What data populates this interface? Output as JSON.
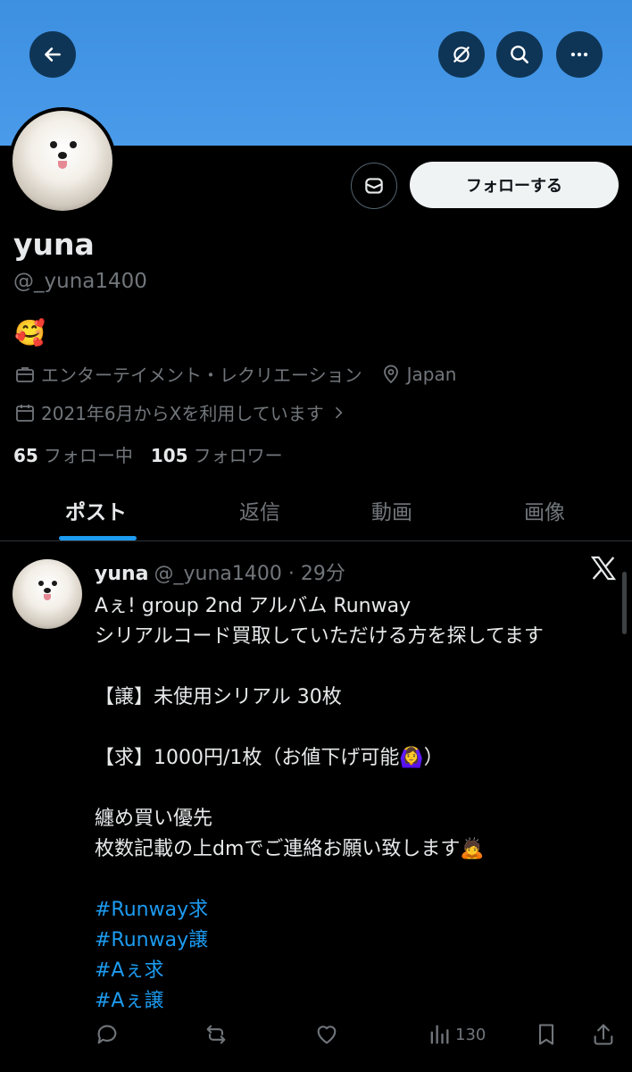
{
  "header": {
    "back_icon": "arrow-left-icon",
    "translate_icon": "grok-icon",
    "search_icon": "search-icon",
    "more_icon": "more-icon"
  },
  "profile": {
    "dm_icon": "mail-icon",
    "follow_label": "フォローする",
    "name": "yuna",
    "handle": "@_yuna1400",
    "bio": "🥰",
    "category": "エンターテイメント・レクリエーション",
    "location": "Japan",
    "joined": "2021年6月からXを利用しています",
    "following_count": "65",
    "following_label": "フォロー中",
    "followers_count": "105",
    "followers_label": "フォロワー"
  },
  "tabs": [
    {
      "label": "ポスト"
    },
    {
      "label": "返信"
    },
    {
      "label": "動画"
    },
    {
      "label": "画像"
    }
  ],
  "post": {
    "name": "yuna",
    "handle": "@_yuna1400",
    "time": "· 29分",
    "lines": [
      "Aぇ! group 2nd アルバム Runway",
      "シリアルコード買取していただける方を探してます",
      "【譲】未使用シリアル 30枚",
      "【求】1000円/1枚（お値下げ可能🙆‍♀️）",
      "纏め買い優先",
      "枚数記載の上dmでご連絡お願い致します🙇"
    ],
    "hashtags": [
      "#Runway求",
      "#Runway譲",
      "#Aぇ求",
      "#Aぇ譲"
    ],
    "views": "130"
  },
  "colors": {
    "banner": "#4a9bea",
    "accent": "#1d9bf0",
    "background": "#000000",
    "muted": "#71767b"
  }
}
